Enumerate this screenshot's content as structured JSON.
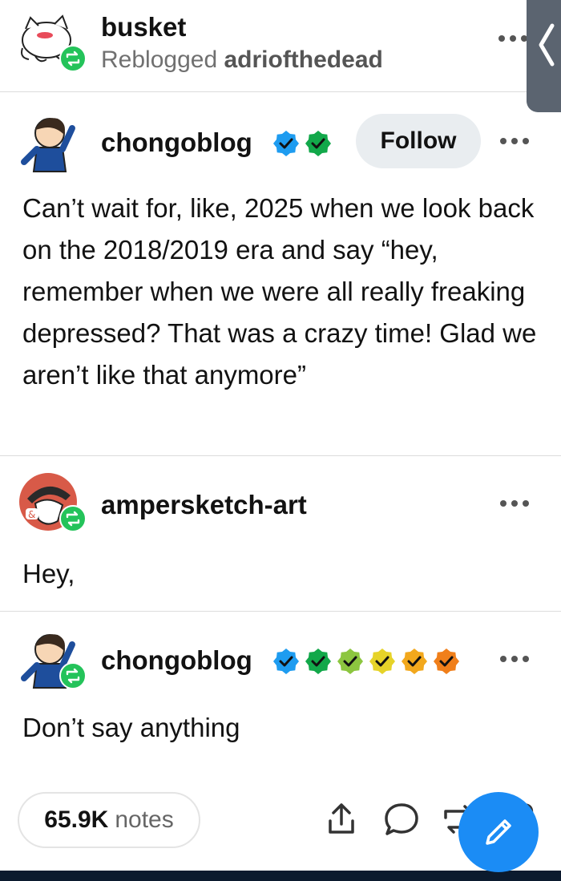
{
  "reblog_header": {
    "username": "busket",
    "reblogged_prefix": "Reblogged",
    "reblogged_from": "adriofthedead",
    "more_icon": "more-dots-icon"
  },
  "side_tab": {
    "icon": "chevron-left-icon"
  },
  "original_post": {
    "username": "chongoblog",
    "follow_label": "Follow",
    "text": "Can’t wait for, like, 2025 when we look back on the 2018/2019 era and say “hey, remember when we were all really freaking depressed? That was a crazy time! Glad we aren’t like that anymore”",
    "badges": [
      {
        "icon": "verified-badge-icon",
        "color": "#1e9cf0"
      },
      {
        "icon": "verified-badge-icon",
        "color": "#12a84a"
      }
    ]
  },
  "reply_1": {
    "username": "ampersketch-art",
    "text": "Hey,"
  },
  "reply_2": {
    "username": "chongoblog",
    "text": "Don’t say anything",
    "badges": [
      {
        "icon": "verified-badge-icon",
        "color": "#1e9cf0"
      },
      {
        "icon": "verified-badge-icon",
        "color": "#12a84a"
      },
      {
        "icon": "verified-badge-icon",
        "color": "#8cc63f"
      },
      {
        "icon": "verified-badge-icon",
        "color": "#e6d329"
      },
      {
        "icon": "verified-badge-icon",
        "color": "#f2a81d"
      },
      {
        "icon": "verified-badge-icon",
        "color": "#f07f1a"
      }
    ]
  },
  "footer": {
    "notes_count": "65.9K",
    "notes_label": "notes",
    "actions": [
      "share-icon",
      "comment-icon",
      "reblog-icon",
      "like-icon"
    ],
    "compose_icon": "pencil-icon"
  },
  "colors": {
    "reblog_green": "#24c35a",
    "fab_blue": "#1b8cf5",
    "follow_bg": "#e9edf0"
  }
}
